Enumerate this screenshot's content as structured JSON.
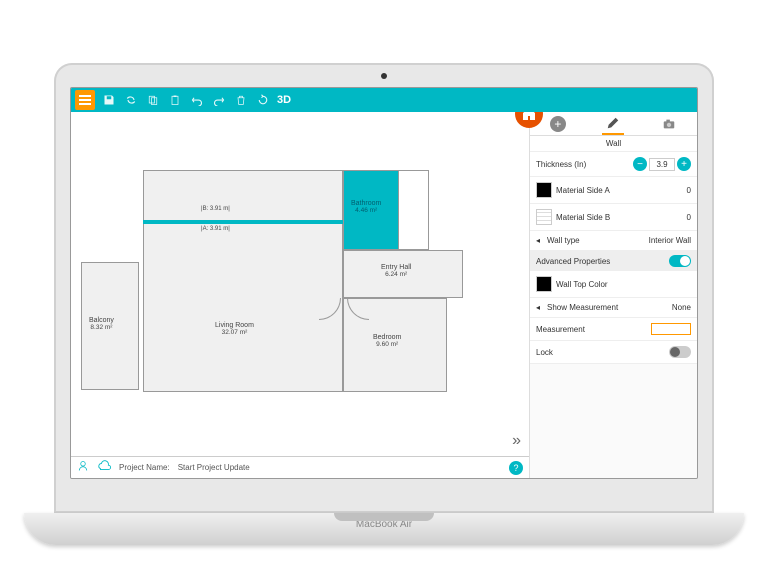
{
  "toolbar": {
    "view3d": "3D"
  },
  "panel": {
    "title": "Wall",
    "thickness_label": "Thickness (In)",
    "thickness_value": "3.9",
    "material_a": "Material Side A",
    "material_a_val": "0",
    "material_b": "Material Side B",
    "material_b_val": "0",
    "wall_type_label": "Wall type",
    "wall_type_value": "Interior Wall",
    "advanced_label": "Advanced Properties",
    "wall_top_color": "Wall Top Color",
    "show_measurement_label": "Show Measurement",
    "show_measurement_value": "None",
    "measurement_label": "Measurement",
    "lock_label": "Lock"
  },
  "rooms": {
    "balcony": {
      "name": "Balcony",
      "area": "8.32 m²"
    },
    "living": {
      "name": "Living Room",
      "area": "32.07 m²"
    },
    "bathroom": {
      "name": "Bathroom",
      "area": "4.46 m²"
    },
    "entry": {
      "name": "Entry Hall",
      "area": "6.24 m²"
    },
    "bedroom": {
      "name": "Bedroom",
      "area": "9.60 m²"
    }
  },
  "measurements": {
    "line_b": "B: 3.91 m",
    "line_a": "A: 3.91 m"
  },
  "footer": {
    "project_label": "Project Name:",
    "project_name": "Start Project Update"
  },
  "laptop_brand": "MacBook Air"
}
